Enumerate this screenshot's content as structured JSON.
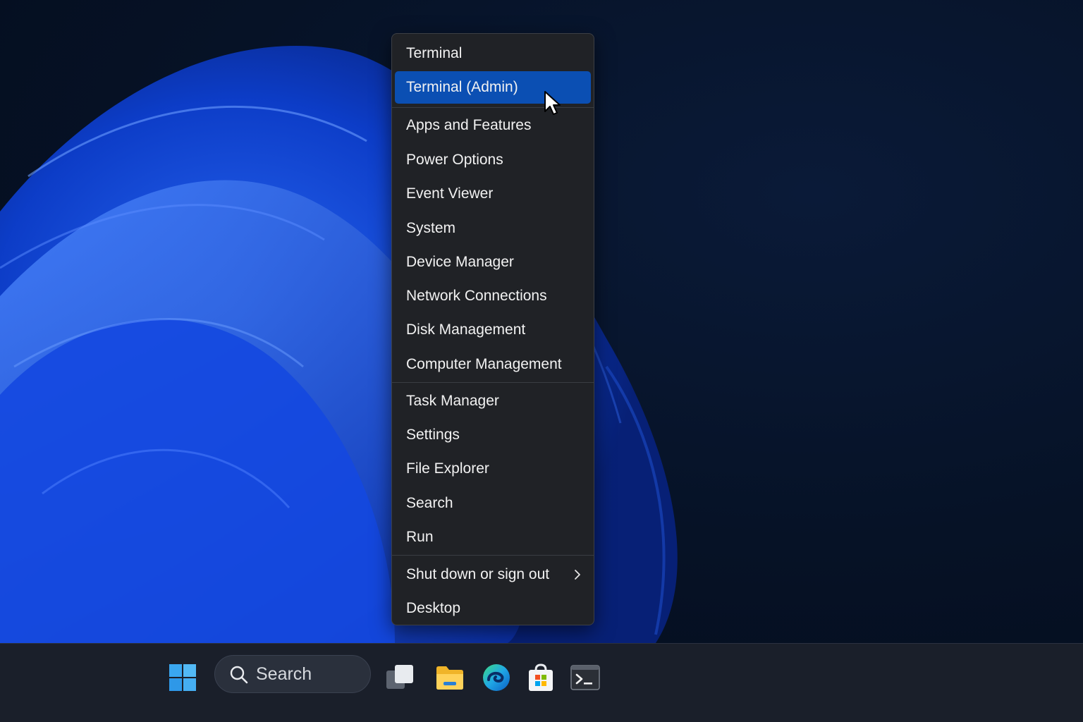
{
  "context_menu": {
    "items": [
      {
        "label": "Terminal"
      },
      {
        "label": "Terminal (Admin)",
        "active": true
      },
      {
        "label": "Apps and Features"
      },
      {
        "label": "Power Options"
      },
      {
        "label": "Event Viewer"
      },
      {
        "label": "System"
      },
      {
        "label": "Device Manager"
      },
      {
        "label": "Network Connections"
      },
      {
        "label": "Disk Management"
      },
      {
        "label": "Computer Management"
      },
      {
        "label": "Task Manager"
      },
      {
        "label": "Settings"
      },
      {
        "label": "File Explorer"
      },
      {
        "label": "Search"
      },
      {
        "label": "Run"
      },
      {
        "label": "Shut down or sign out",
        "has_submenu": true
      },
      {
        "label": "Desktop"
      }
    ],
    "highlight_color": "#0b4fb3"
  },
  "taskbar": {
    "search_label": "Search",
    "icons": [
      "windows-start-icon",
      "search-icon",
      "task-view-icon",
      "file-explorer-icon",
      "edge-icon",
      "microsoft-store-icon",
      "terminal-icon"
    ]
  }
}
